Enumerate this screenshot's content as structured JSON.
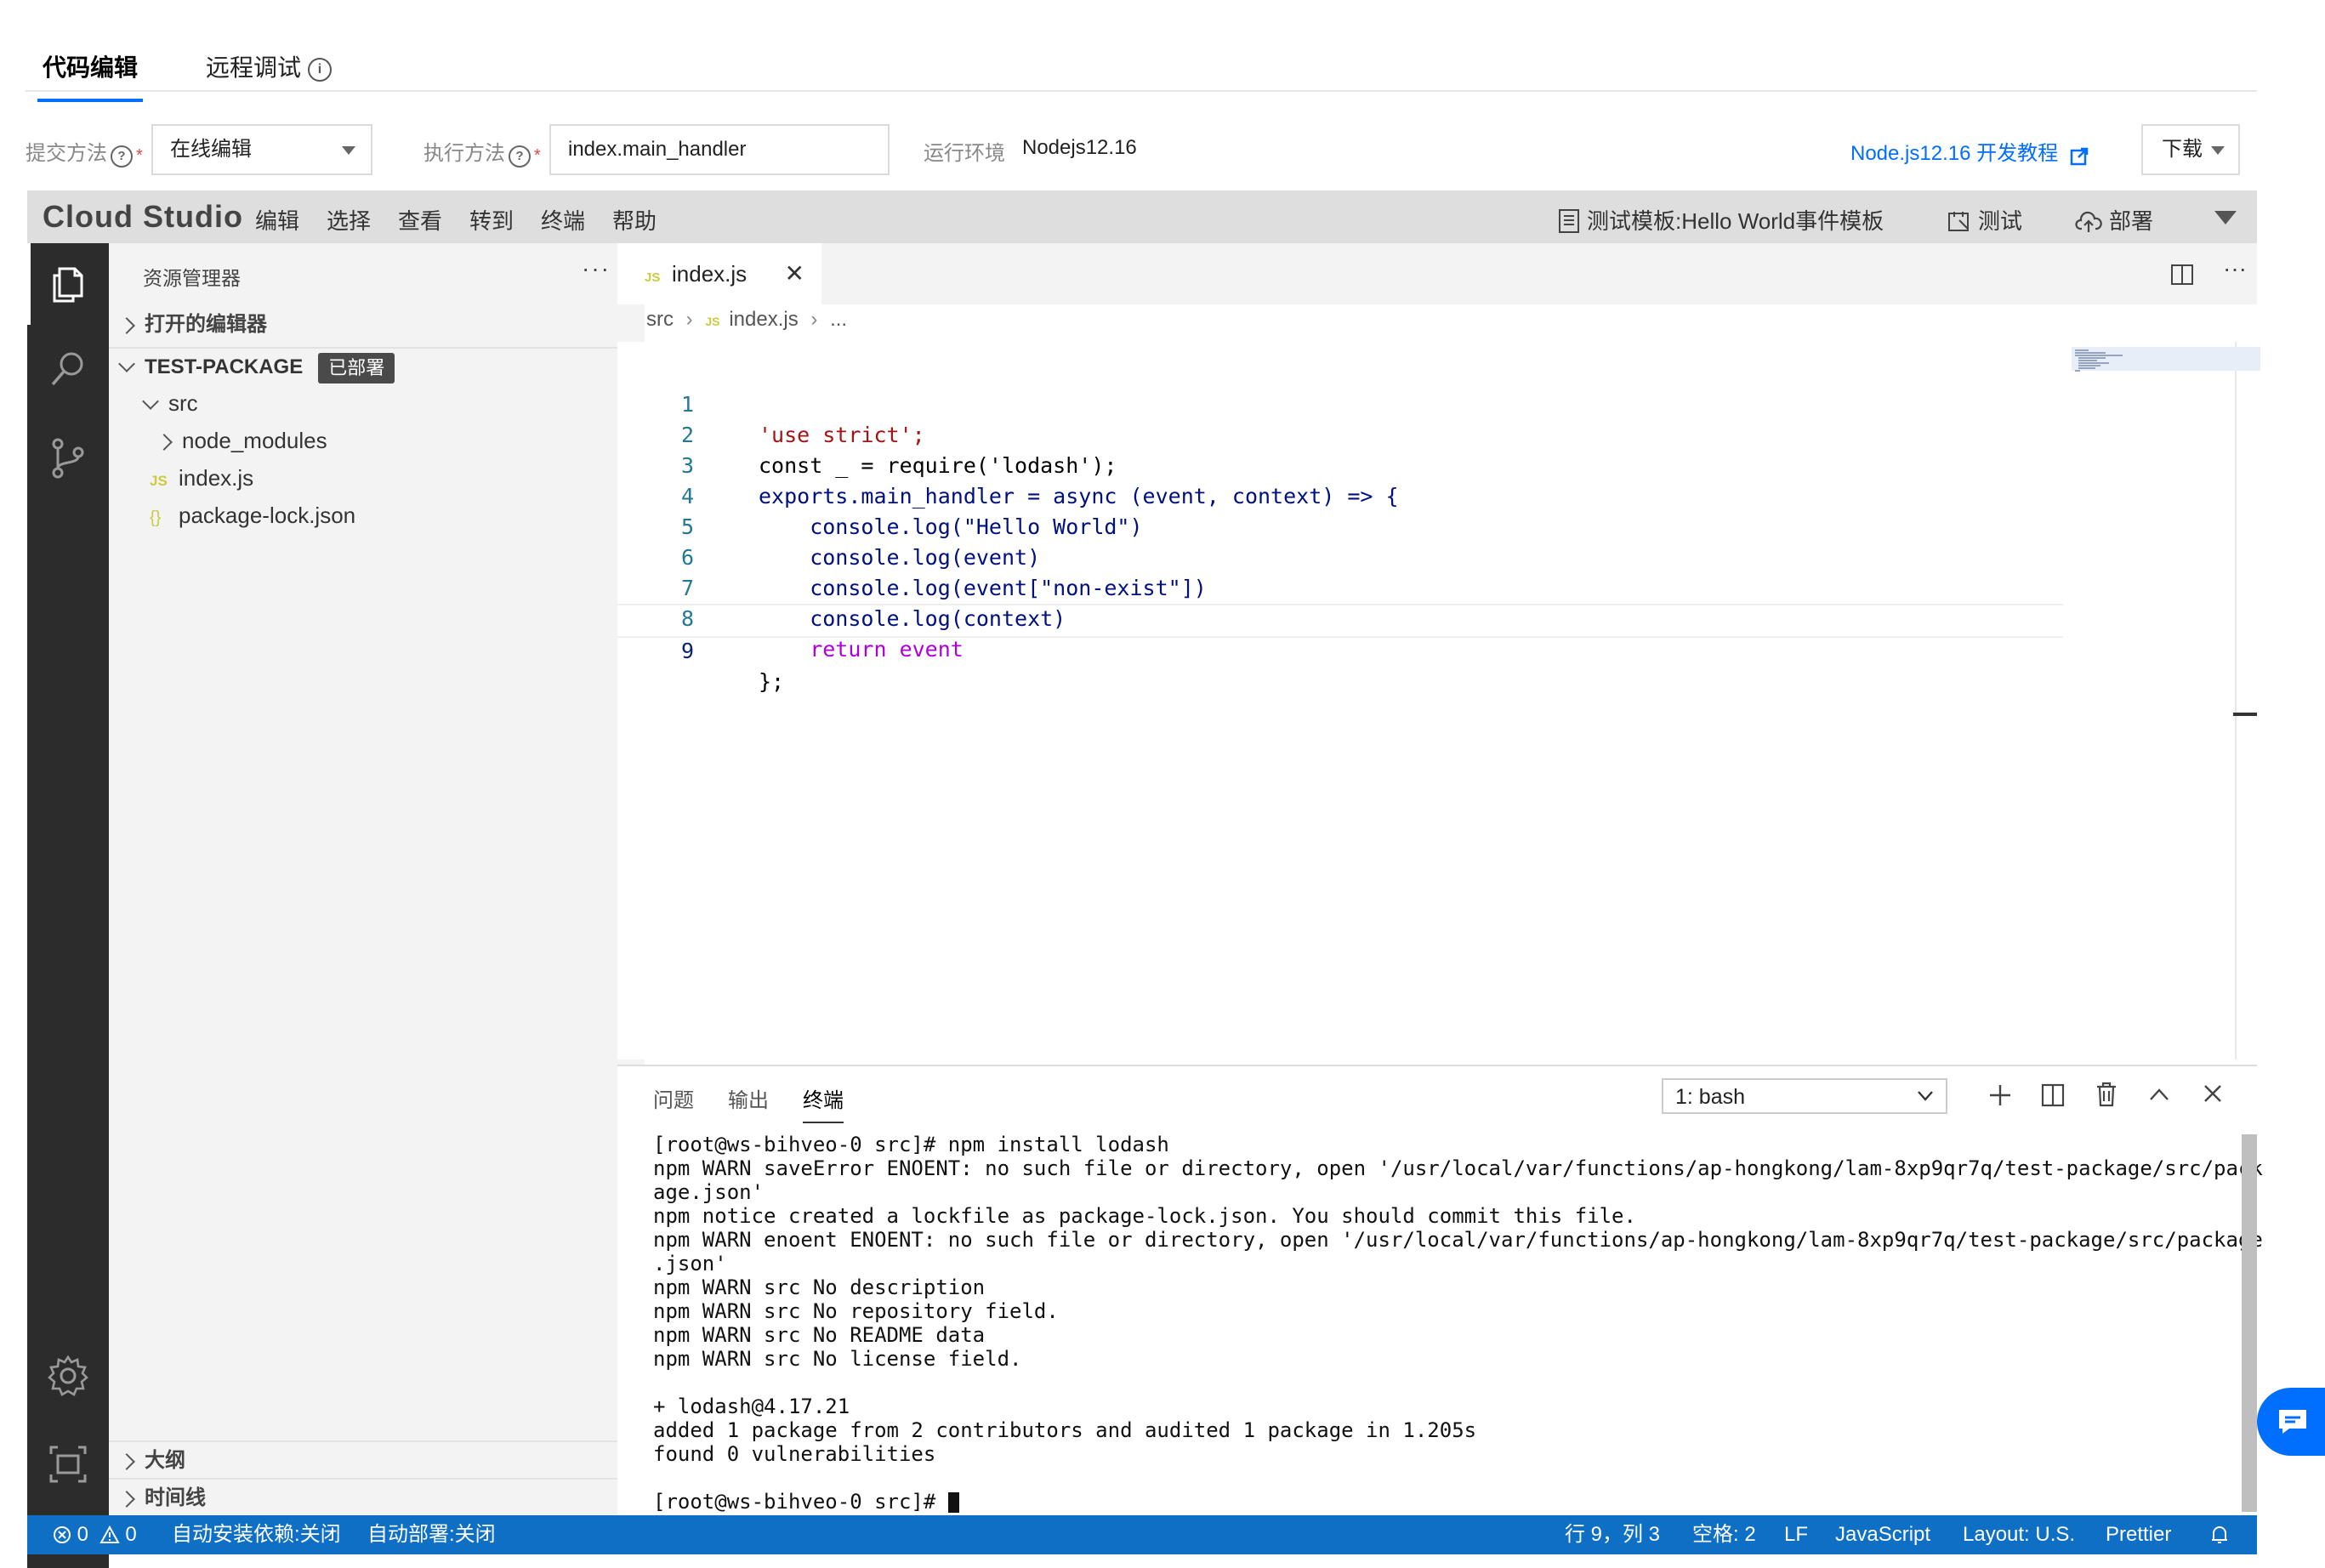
{
  "top_tabs": {
    "code_edit": "代码编辑",
    "remote_debug": "远程调试"
  },
  "form": {
    "submit_label": "提交方法",
    "submit_value": "在线编辑",
    "exec_label": "执行方法",
    "exec_value": "index.main_handler",
    "runtime_label": "运行环境",
    "runtime_value": "Nodejs12.16",
    "tutorial_link": "Node.js12.16 开发教程",
    "download": "下载"
  },
  "menubar": {
    "brand": "Cloud Studio",
    "items": [
      "编辑",
      "选择",
      "查看",
      "转到",
      "终端",
      "帮助"
    ],
    "test_template": "测试模板:Hello World事件模板",
    "test": "测试",
    "deploy": "部署"
  },
  "sidebar": {
    "title": "资源管理器",
    "open_editors": "打开的编辑器",
    "project": "TEST-PACKAGE",
    "deployed_badge": "已部署",
    "src": "src",
    "node_modules": "node_modules",
    "index_js": "index.js",
    "package_lock": "package-lock.json",
    "outline": "大纲",
    "timeline": "时间线"
  },
  "editor": {
    "tab_name": "index.js",
    "breadcrumb_src": "src",
    "breadcrumb_file": "index.js",
    "breadcrumb_more": "...",
    "line_numbers": [
      "1",
      "2",
      "3",
      "4",
      "5",
      "6",
      "7",
      "8",
      "9"
    ],
    "line_texts": [
      "'use strict';",
      "const _ = require('lodash');",
      "exports.main_handler = async (event, context) => {",
      "    console.log(\"Hello World\")",
      "    console.log(event)",
      "    console.log(event[\"non-exist\"])",
      "    console.log(context)",
      "    return event",
      "};"
    ]
  },
  "panel": {
    "tabs": [
      "问题",
      "输出",
      "终端"
    ],
    "terminal_select": "1: bash",
    "terminal_lines": [
      "[root@ws-bihveo-0 src]# npm install lodash",
      "npm WARN saveError ENOENT: no such file or directory, open '/usr/local/var/functions/ap-hongkong/lam-8xp9qr7q/test-package/src/pack",
      "age.json'",
      "npm notice created a lockfile as package-lock.json. You should commit this file.",
      "npm WARN enoent ENOENT: no such file or directory, open '/usr/local/var/functions/ap-hongkong/lam-8xp9qr7q/test-package/src/package",
      ".json'",
      "npm WARN src No description",
      "npm WARN src No repository field.",
      "npm WARN src No README data",
      "npm WARN src No license field.",
      "",
      "+ lodash@4.17.21",
      "added 1 package from 2 contributors and audited 1 package in 1.205s",
      "found 0 vulnerabilities",
      "",
      "[root@ws-bihveo-0 src]# "
    ]
  },
  "statusbar": {
    "errors": "0",
    "warnings": "0",
    "auto_install": "自动安装依赖:关闭",
    "auto_deploy": "自动部署:关闭",
    "position": "行 9，列 3",
    "spaces": "空格: 2",
    "eol": "LF",
    "language": "JavaScript",
    "layout": "Layout: U.S.",
    "prettier": "Prettier"
  },
  "colors": {
    "accent": "#006eff",
    "statusbar": "#0e6fc5",
    "activitybar": "#2c2c2c"
  }
}
